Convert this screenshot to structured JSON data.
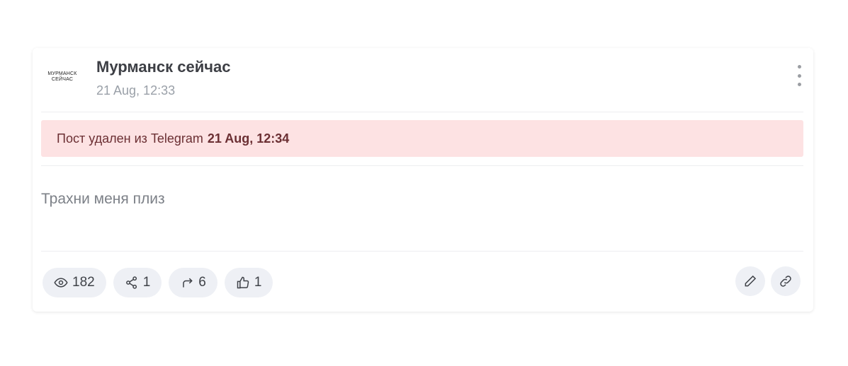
{
  "post": {
    "logo_line1": "МУРМАНСК",
    "logo_line2": "СЕЙЧАС",
    "channel_name": "Мурманск сейчас",
    "timestamp": "21 Aug, 12:33",
    "deleted_notice_prefix": "Пост удален из Telegram",
    "deleted_notice_time": "21 Aug, 12:34",
    "text": "Трахни меня плиз"
  },
  "stats": {
    "views": "182",
    "shares": "1",
    "forwards": "6",
    "likes": "1"
  },
  "icons": {
    "menu": "kebab-menu-icon",
    "views": "eye-icon",
    "shares": "share-icon",
    "forwards": "forward-arrow-icon",
    "likes": "thumbs-up-icon",
    "edit": "pencil-icon",
    "link": "link-icon"
  },
  "colors": {
    "deleted_bg": "#fde2e3",
    "pill_bg": "#eef0f5",
    "title": "#3d3f45",
    "muted": "#9aa0a8"
  }
}
